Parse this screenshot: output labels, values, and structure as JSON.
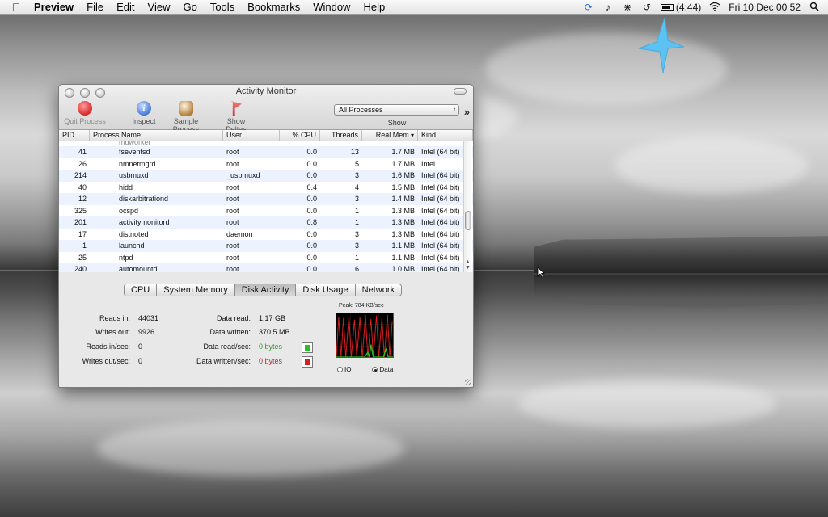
{
  "menubar": {
    "app_name": "Preview",
    "menus": [
      "File",
      "Edit",
      "View",
      "Go",
      "Tools",
      "Bookmarks",
      "Window",
      "Help"
    ],
    "battery": "(4:44)",
    "clock": "Fri 10 Dec  00 52",
    "icons": [
      "apple-icon",
      "sync-icon",
      "music-icon",
      "bluetooth-icon",
      "time-machine-icon",
      "battery-icon",
      "wifi-icon",
      "spotlight-icon"
    ]
  },
  "window": {
    "title": "Activity Monitor",
    "toolbar": {
      "quit": "Quit Process",
      "inspect": "Inspect",
      "inspect_glyph": "i",
      "sample": "Sample Process",
      "deltas": "Show Deltas",
      "show_value": "All Processes",
      "show_label": "Show"
    },
    "columns": [
      "PID",
      "Process Name",
      "User",
      "% CPU",
      "Threads",
      "Real Mem",
      "Kind"
    ],
    "partial_row": "mdworker",
    "rows": [
      {
        "pid": "41",
        "name": "fseventsd",
        "user": "root",
        "cpu": "0.0",
        "threads": "13",
        "mem": "1.7 MB",
        "kind": "Intel (64 bit)"
      },
      {
        "pid": "26",
        "name": "nmnetmgrd",
        "user": "root",
        "cpu": "0.0",
        "threads": "5",
        "mem": "1.7 MB",
        "kind": "Intel"
      },
      {
        "pid": "214",
        "name": "usbmuxd",
        "user": "_usbmuxd",
        "cpu": "0.0",
        "threads": "3",
        "mem": "1.6 MB",
        "kind": "Intel (64 bit)"
      },
      {
        "pid": "40",
        "name": "hidd",
        "user": "root",
        "cpu": "0.4",
        "threads": "4",
        "mem": "1.5 MB",
        "kind": "Intel (64 bit)"
      },
      {
        "pid": "12",
        "name": "diskarbitrationd",
        "user": "root",
        "cpu": "0.0",
        "threads": "3",
        "mem": "1.4 MB",
        "kind": "Intel (64 bit)"
      },
      {
        "pid": "325",
        "name": "ocspd",
        "user": "root",
        "cpu": "0.0",
        "threads": "1",
        "mem": "1.3 MB",
        "kind": "Intel (64 bit)"
      },
      {
        "pid": "201",
        "name": "activitymonitord",
        "user": "root",
        "cpu": "0.8",
        "threads": "1",
        "mem": "1.3 MB",
        "kind": "Intel (64 bit)"
      },
      {
        "pid": "17",
        "name": "distnoted",
        "user": "daemon",
        "cpu": "0.0",
        "threads": "3",
        "mem": "1.3 MB",
        "kind": "Intel (64 bit)"
      },
      {
        "pid": "1",
        "name": "launchd",
        "user": "root",
        "cpu": "0.0",
        "threads": "3",
        "mem": "1.1 MB",
        "kind": "Intel (64 bit)"
      },
      {
        "pid": "25",
        "name": "ntpd",
        "user": "root",
        "cpu": "0.0",
        "threads": "1",
        "mem": "1.1 MB",
        "kind": "Intel (64 bit)"
      },
      {
        "pid": "240",
        "name": "automountd",
        "user": "root",
        "cpu": "0.0",
        "threads": "6",
        "mem": "1.0 MB",
        "kind": "Intel (64 bit)"
      }
    ],
    "tabs": [
      "CPU",
      "System Memory",
      "Disk Activity",
      "Disk Usage",
      "Network"
    ],
    "active_tab": "Disk Activity",
    "disk": {
      "reads_in_label": "Reads in:",
      "reads_in": "44031",
      "writes_out_label": "Writes out:",
      "writes_out": "9926",
      "reads_sec_label": "Reads in/sec:",
      "reads_sec": "0",
      "writes_sec_label": "Writes out/sec:",
      "writes_sec": "0",
      "data_read_label": "Data read:",
      "data_read": "1.17 GB",
      "data_written_label": "Data written:",
      "data_written": "370.5 MB",
      "data_read_sec_label": "Data read/sec:",
      "data_read_sec": "0 bytes",
      "data_written_sec_label": "Data written/sec:",
      "data_written_sec": "0 bytes",
      "peak": "Peak: 784 KB/sec",
      "radio_io": "IO",
      "radio_data": "Data",
      "read_color": "#22c322",
      "write_color": "#d81f1f"
    }
  }
}
